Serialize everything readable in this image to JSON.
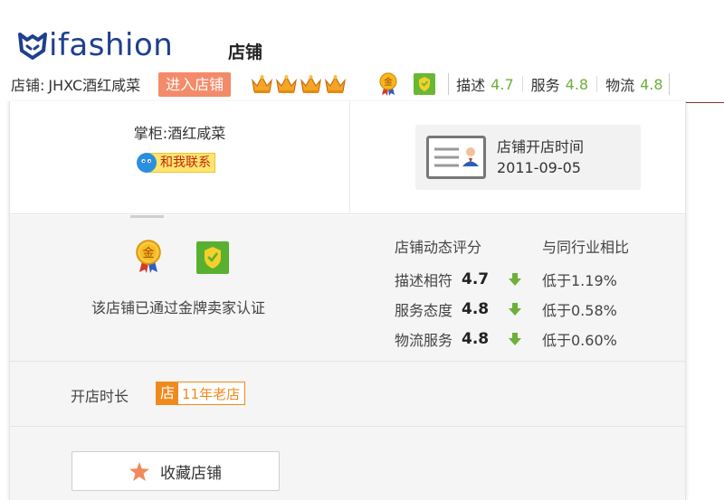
{
  "header": {
    "logo_text": "ifashion",
    "page_title": "店铺",
    "logo_icon": "fox-head-logo"
  },
  "shopbar": {
    "shop_label": "店铺:",
    "shop_name": "JHXC酒红咸菜",
    "enter_button": "进入店铺",
    "crown_count": 4,
    "crown_icon": "crown-icon",
    "gold_seller_icon": "gold-medal-icon",
    "consumer_protection_icon": "shield-icon",
    "scores": [
      {
        "label": "描述",
        "value": "4.7"
      },
      {
        "label": "服务",
        "value": "4.8"
      },
      {
        "label": "物流",
        "value": "4.8"
      }
    ]
  },
  "panel": {
    "keeper": "掌柜:酒红咸菜",
    "contact_label": "和我联系",
    "open_time_label": "店铺开店时间",
    "open_time_value": "2011-09-05",
    "cert_text": "该店铺已通过金牌卖家认证",
    "rating_header": "店铺动态评分",
    "compare_header": "与同行业相比",
    "ratings": [
      {
        "name": "描述相符",
        "value": "4.7",
        "trend": "down",
        "compare": "低于1.19%"
      },
      {
        "name": "服务态度",
        "value": "4.8",
        "trend": "down",
        "compare": "低于0.58%"
      },
      {
        "name": "物流服务",
        "value": "4.8",
        "trend": "down",
        "compare": "低于0.60%"
      }
    ],
    "age_label": "开店时长",
    "age_badge_char": "店",
    "age_badge_text": "11年老店",
    "favorite_button": "收藏店铺"
  },
  "colors": {
    "brand": "#1f3f8f",
    "enter_button": "#f38b6a",
    "score_green": "#6fae3a",
    "badge_orange": "#f08a1d",
    "star": "#f08a5d"
  }
}
